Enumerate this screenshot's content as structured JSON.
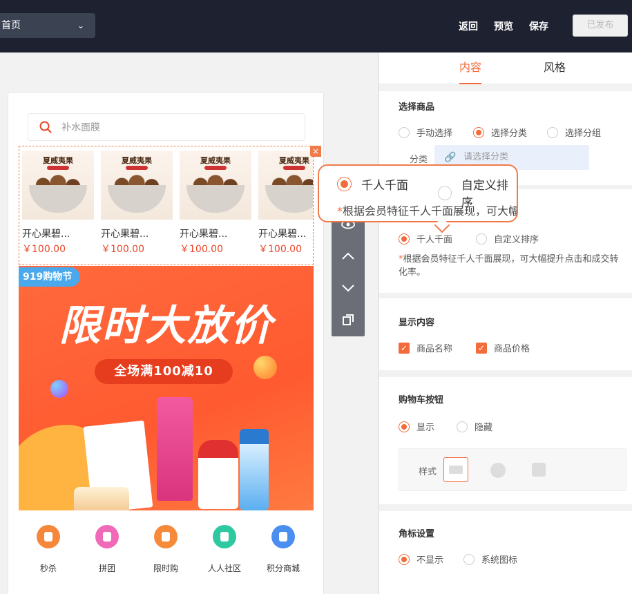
{
  "topbar": {
    "page_select": "首页",
    "back": "返回",
    "preview": "预览",
    "save": "保存",
    "publish": "已发布"
  },
  "search": {
    "placeholder": "补水面膜"
  },
  "goods": [
    {
      "banner": "夏威夷果",
      "name": "开心果碧...",
      "price": "￥100.00"
    },
    {
      "banner": "夏威夷果",
      "name": "开心果碧...",
      "price": "￥100.00"
    },
    {
      "banner": "夏威夷果",
      "name": "开心果碧...",
      "price": "￥100.00"
    },
    {
      "banner": "夏威夷果",
      "name": "开心果碧...",
      "price": "￥100.00"
    }
  ],
  "banner": {
    "festival": "919购物节",
    "headline": "限时大放价",
    "promo": "全场满100减10"
  },
  "nav": [
    {
      "label": "秒杀",
      "color": "#f5873a"
    },
    {
      "label": "拼团",
      "color": "#f06ab8"
    },
    {
      "label": "限时购",
      "color": "#f58a3a"
    },
    {
      "label": "人人社区",
      "color": "#2ec9a0"
    },
    {
      "label": "积分商城",
      "color": "#4a8ff0"
    }
  ],
  "panel": {
    "tabs": [
      "内容",
      "风格"
    ],
    "select_goods": {
      "title": "选择商品",
      "options": [
        "手动选择",
        "选择分类",
        "选择分组"
      ],
      "selected": "选择分类",
      "category_label": "分类",
      "category_placeholder": "请选择分类"
    },
    "sort": {
      "options": [
        "千人千面",
        "自定义排序"
      ],
      "selected": "千人千面",
      "note": "根据会员特征千人千面展现，可大幅提升点击和成交转化率。",
      "star": "*"
    },
    "display": {
      "title": "显示内容",
      "options": [
        "商品名称",
        "商品价格"
      ]
    },
    "cart": {
      "title": "购物车按钮",
      "options": [
        "显示",
        "隐藏"
      ],
      "selected": "显示",
      "style_label": "样式"
    },
    "corner": {
      "title": "角标设置",
      "options": [
        "不显示",
        "系统图标"
      ],
      "selected": "不显示"
    }
  },
  "popover": {
    "options": [
      "千人千面",
      "自定义排序"
    ],
    "note": "根据会员特征千人千面展现，可大幅提升点击和成交转化率。",
    "star": "*"
  },
  "accent": "#f26b3a"
}
